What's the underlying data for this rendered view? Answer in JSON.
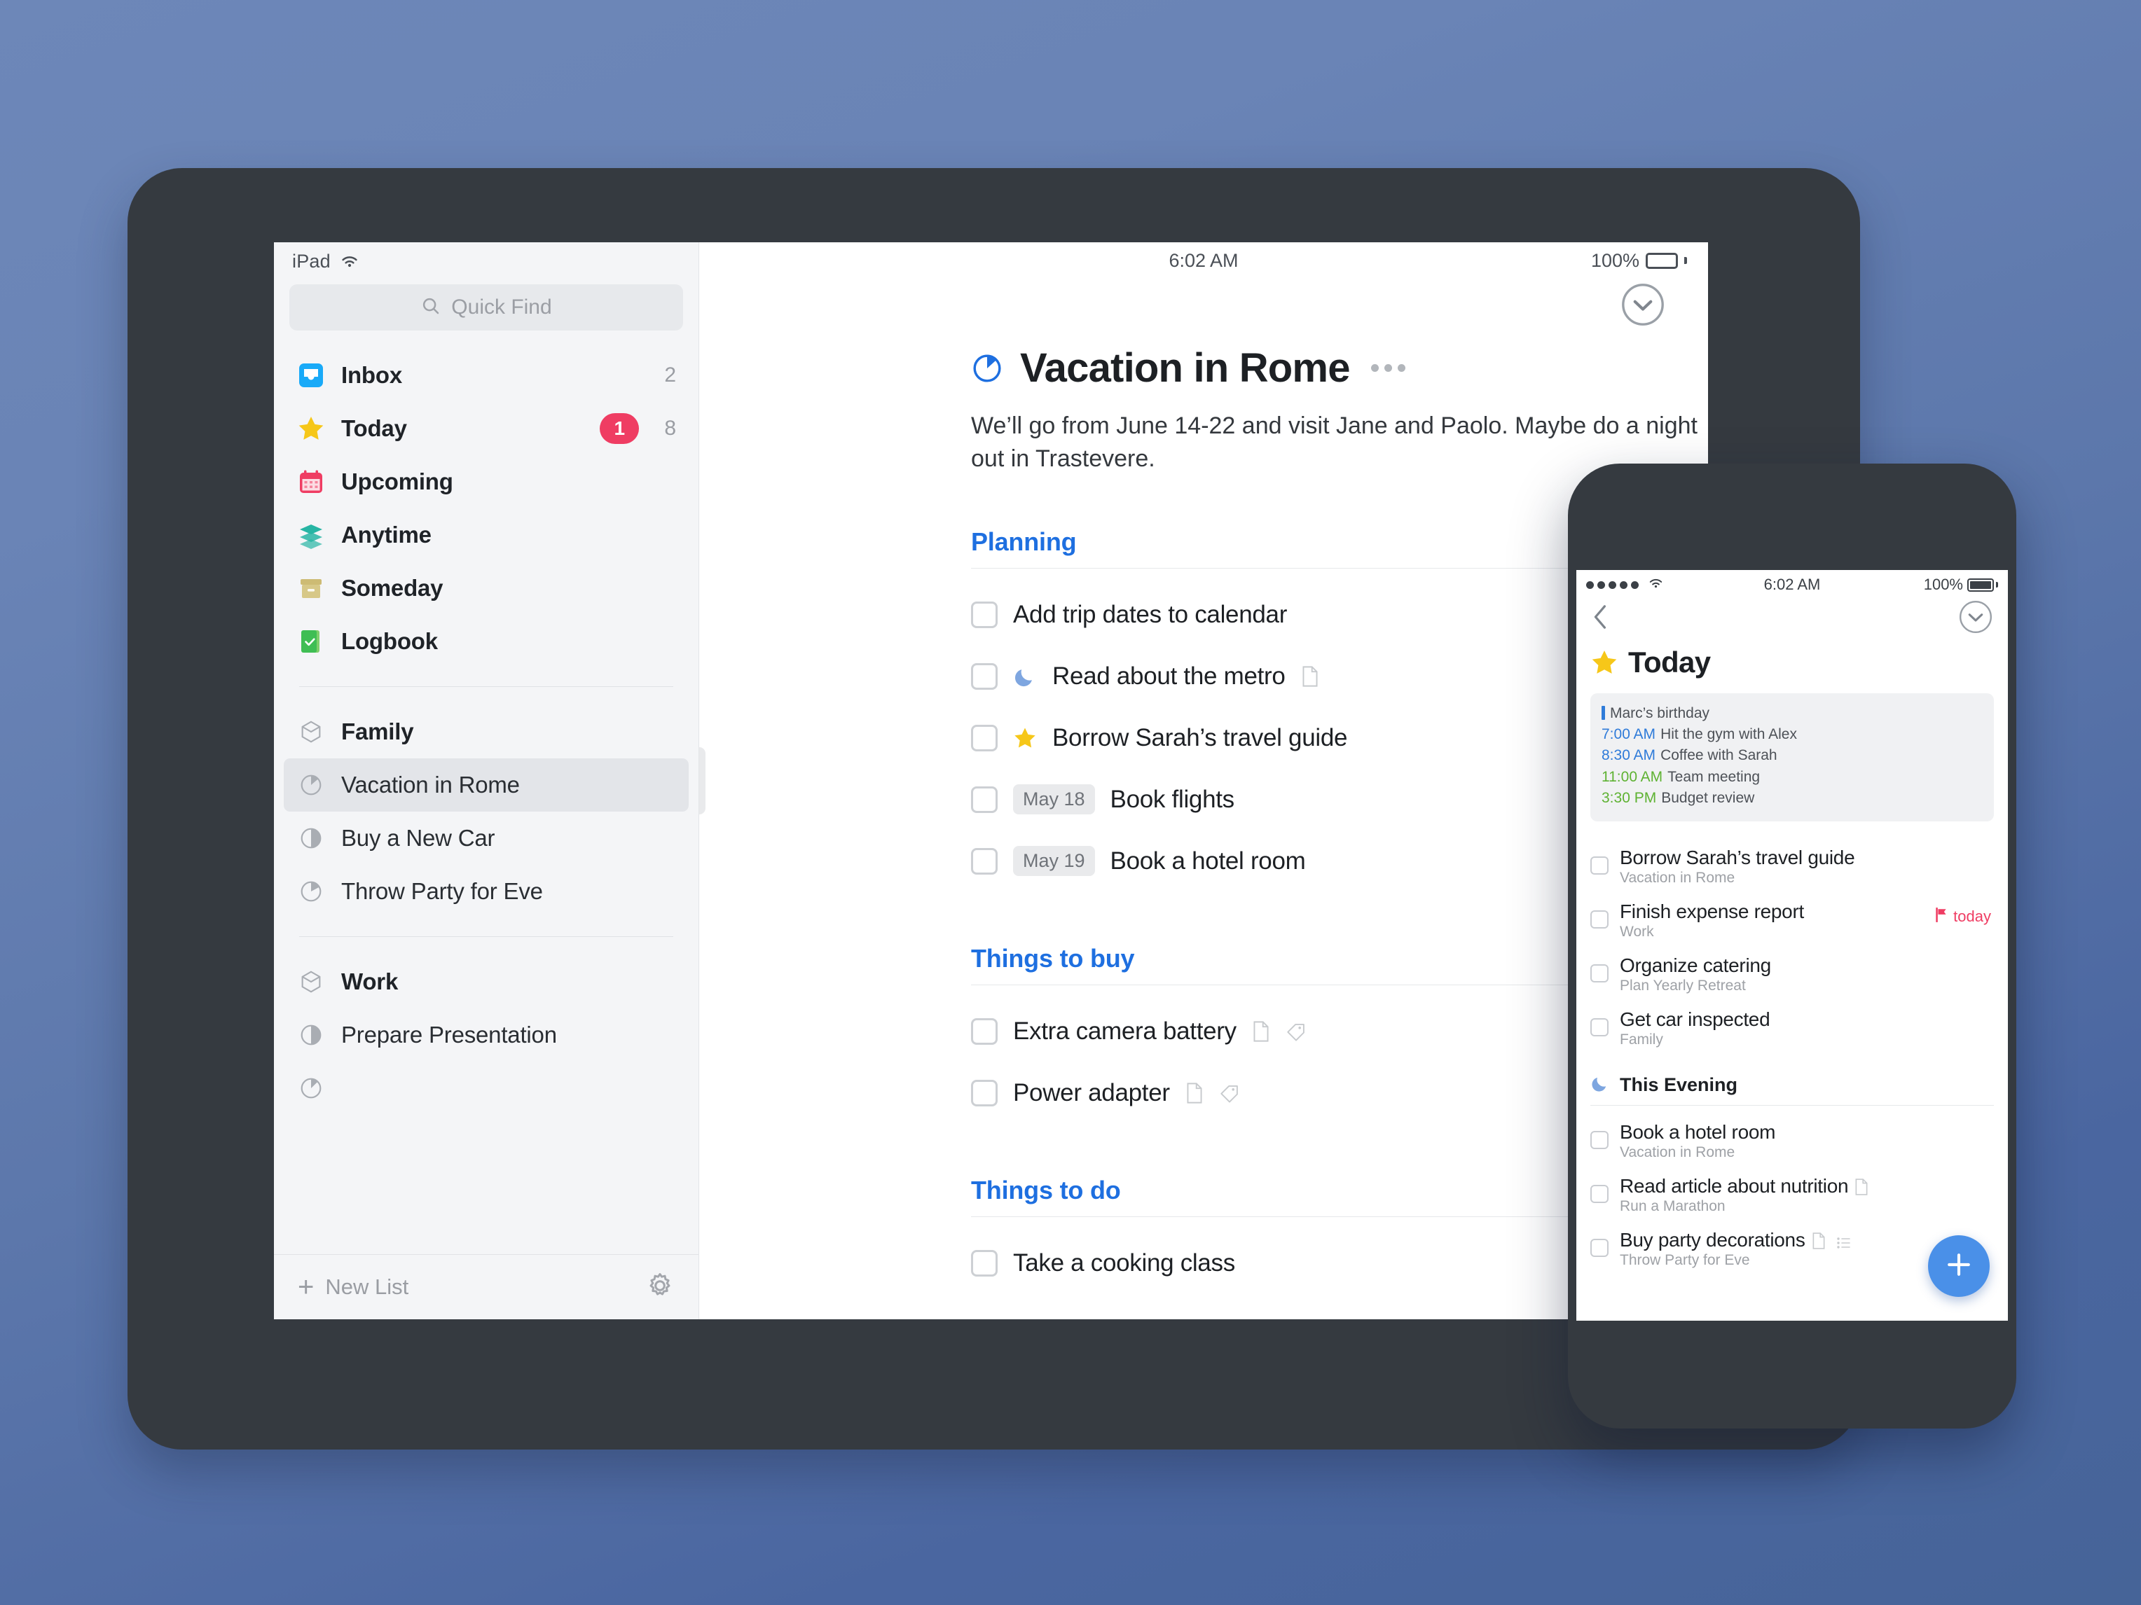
{
  "ipad": {
    "status": {
      "device": "iPad",
      "wifi_icon": "wifi-icon",
      "time": "6:02 AM",
      "battery_pct": "100%"
    },
    "search": {
      "placeholder": "Quick Find",
      "icon": "search-icon"
    },
    "nav": [
      {
        "label": "Inbox",
        "icon": "inbox-icon",
        "count": "2",
        "badge": ""
      },
      {
        "label": "Today",
        "icon": "star-icon",
        "count": "8",
        "badge": "1"
      },
      {
        "label": "Upcoming",
        "icon": "calendar-icon",
        "count": "",
        "badge": ""
      },
      {
        "label": "Anytime",
        "icon": "layers-icon",
        "count": "",
        "badge": ""
      },
      {
        "label": "Someday",
        "icon": "box-icon",
        "count": "",
        "badge": ""
      },
      {
        "label": "Logbook",
        "icon": "logbook-icon",
        "count": "",
        "badge": ""
      }
    ],
    "areas": [
      {
        "label": "Family",
        "icon": "area-icon",
        "projects": [
          {
            "label": "Vacation in Rome",
            "icon": "pie-icon",
            "selected": true
          },
          {
            "label": "Buy a New Car",
            "icon": "pie-icon",
            "selected": false
          },
          {
            "label": "Throw Party for Eve",
            "icon": "pie-icon",
            "selected": false
          }
        ]
      },
      {
        "label": "Work",
        "icon": "area-icon",
        "projects": [
          {
            "label": "Prepare Presentation",
            "icon": "pie-icon",
            "selected": false
          }
        ]
      }
    ],
    "footer": {
      "new_list": "New List",
      "plus_icon": "plus-icon",
      "settings_icon": "gear-icon"
    },
    "project": {
      "title": "Vacation in Rome",
      "icon": "pie-icon",
      "more_icon": "more-dots-icon",
      "note": "We’ll go from June 14-22 and visit Jane and Paolo. Maybe do a night out in Trastevere.",
      "collapse_icon": "chevron-down-circle-icon"
    },
    "sections": [
      {
        "title": "Planning",
        "items": [
          {
            "text": "Add trip dates to calendar",
            "pill": "",
            "moon": false,
            "star": false,
            "note": false,
            "tag": false
          },
          {
            "text": "Read about the metro",
            "pill": "",
            "moon": true,
            "star": false,
            "note": true,
            "tag": false
          },
          {
            "text": "Borrow Sarah’s travel guide",
            "pill": "",
            "moon": false,
            "star": true,
            "note": false,
            "tag": false
          },
          {
            "text": "Book flights",
            "pill": "May 18",
            "moon": false,
            "star": false,
            "note": false,
            "tag": false
          },
          {
            "text": "Book a hotel room",
            "pill": "May 19",
            "moon": false,
            "star": false,
            "note": false,
            "tag": false
          }
        ]
      },
      {
        "title": "Things to buy",
        "items": [
          {
            "text": "Extra camera battery",
            "pill": "",
            "moon": false,
            "star": false,
            "note": true,
            "tag": true
          },
          {
            "text": "Power adapter",
            "pill": "",
            "moon": false,
            "star": false,
            "note": true,
            "tag": true
          }
        ]
      },
      {
        "title": "Things to do",
        "items": [
          {
            "text": "Take a cooking class",
            "pill": "",
            "moon": false,
            "star": false,
            "note": false,
            "tag": false
          }
        ]
      }
    ]
  },
  "phone": {
    "status": {
      "time": "6:02 AM",
      "battery_pct": "100%",
      "wifi_icon": "wifi-icon",
      "signal_icon": "signal-dots-icon"
    },
    "nav": {
      "back_icon": "chevron-left-icon",
      "collapse_icon": "chevron-down-circle-icon"
    },
    "title": "Today",
    "title_icon": "star-icon",
    "calendar": [
      {
        "time": "",
        "text": "Marc’s birthday",
        "color": "blue",
        "allday": true
      },
      {
        "time": "7:00 AM",
        "text": "Hit the gym with Alex",
        "color": "blue",
        "allday": false
      },
      {
        "time": "8:30 AM",
        "text": "Coffee with Sarah",
        "color": "blue",
        "allday": false
      },
      {
        "time": "11:00 AM",
        "text": "Team meeting",
        "color": "green",
        "allday": false
      },
      {
        "time": "3:30 PM",
        "text": "Budget review",
        "color": "green",
        "allday": false
      }
    ],
    "today_items": [
      {
        "title": "Borrow Sarah’s travel guide",
        "sub": "Vacation in Rome",
        "flag": "",
        "note": false,
        "checklist": false
      },
      {
        "title": "Finish expense report",
        "sub": "Work",
        "flag": "today",
        "note": false,
        "checklist": false
      },
      {
        "title": "Organize catering",
        "sub": "Plan Yearly Retreat",
        "flag": "",
        "note": false,
        "checklist": false
      },
      {
        "title": "Get car inspected",
        "sub": "Family",
        "flag": "",
        "note": false,
        "checklist": false
      }
    ],
    "evening": {
      "title": "This Evening",
      "icon": "moon-icon"
    },
    "evening_items": [
      {
        "title": "Book a hotel room",
        "sub": "Vacation in Rome",
        "note": false,
        "checklist": false
      },
      {
        "title": "Read article about nutrition",
        "sub": "Run a Marathon",
        "note": true,
        "checklist": false
      },
      {
        "title": "Buy party decorations",
        "sub": "Throw Party for Eve",
        "note": true,
        "checklist": true
      }
    ],
    "fab": {
      "icon": "plus-icon",
      "color": "#4a90e8"
    }
  },
  "colors": {
    "accent": "#1e6fe0",
    "badge": "#ef3d63",
    "star": "#f6c719",
    "moon": "#7ea6e0",
    "fab": "#4a90e8",
    "bg": "#4f6aa3"
  }
}
